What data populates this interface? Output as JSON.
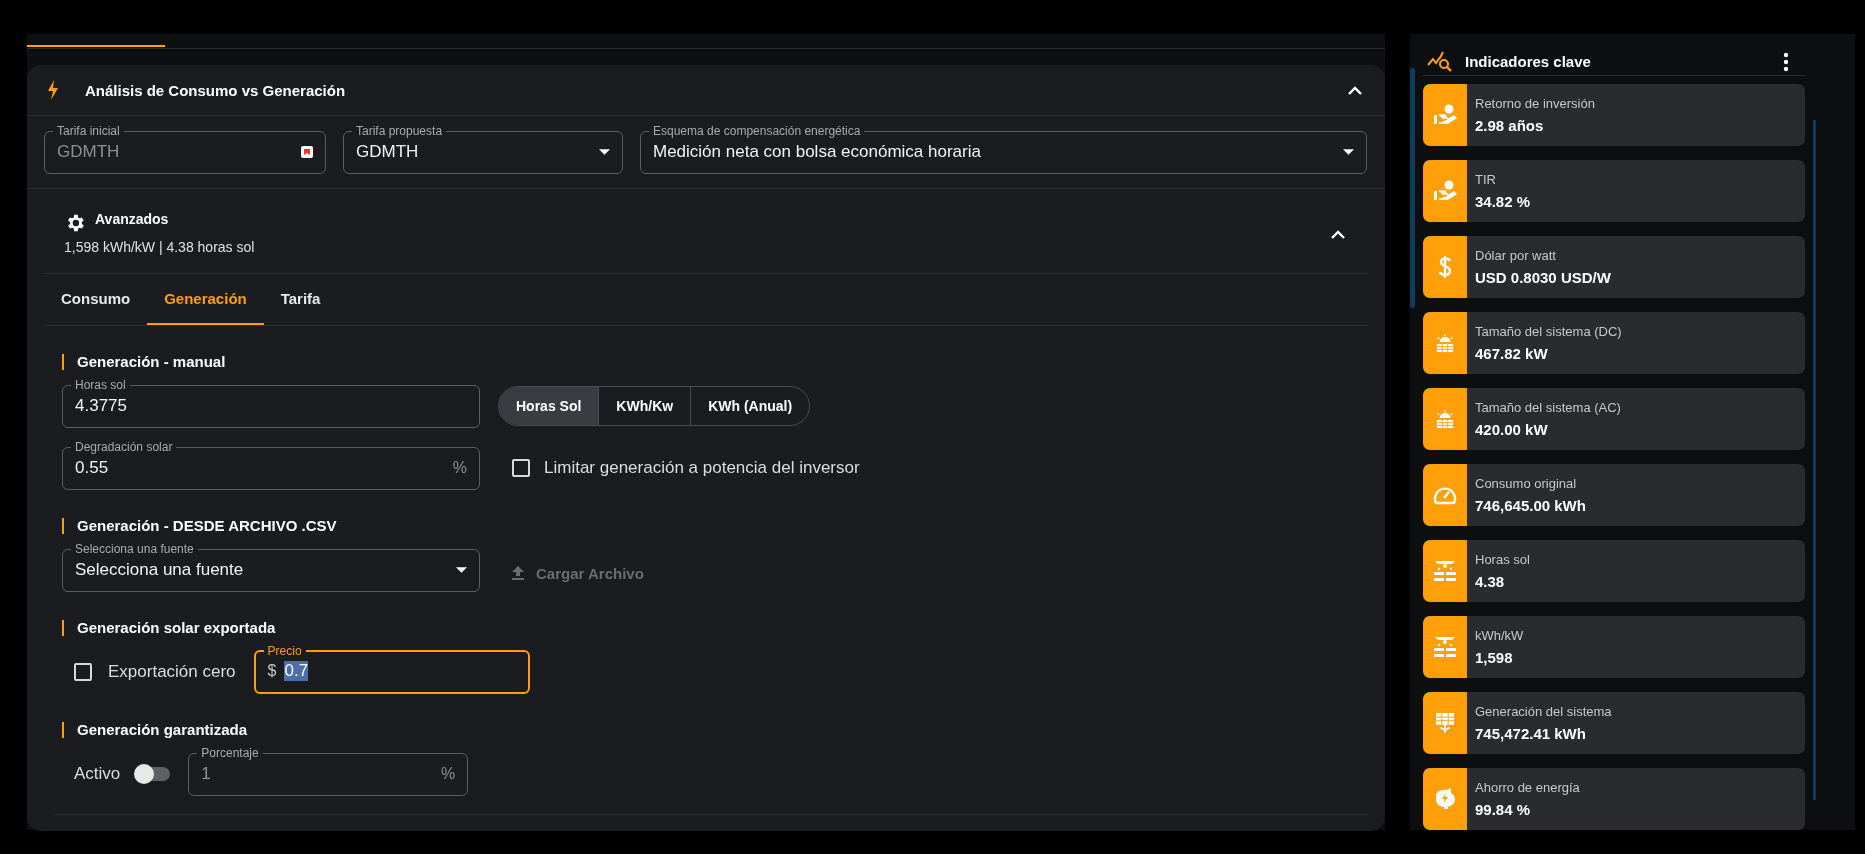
{
  "panel": {
    "title": "Análisis de Consumo vs Generación",
    "expanded": true,
    "fields": [
      {
        "label": "Tarifa inicial",
        "value": "GDMTH",
        "kind": "readonly"
      },
      {
        "label": "Tarifa propuesta",
        "value": "GDMTH",
        "kind": "select"
      },
      {
        "label": "Esquema de compensación energética",
        "value": "Medición neta con bolsa económica horaria",
        "kind": "select"
      }
    ],
    "advanced": {
      "title": "Avanzados",
      "summary": "1,598 kWh/kW | 4.38 horas sol",
      "expanded": true,
      "tabs": [
        {
          "label": "Consumo",
          "selected": false
        },
        {
          "label": "Generación",
          "selected": true
        },
        {
          "label": "Tarifa",
          "selected": false
        }
      ],
      "gen_manual": {
        "title": "Generación - manual",
        "hours": {
          "label": "Horas sol",
          "value": "4.3775"
        },
        "degradation": {
          "label": "Degradación solar",
          "value": "0.55",
          "suffix": "%"
        },
        "units": [
          {
            "label": "Horas Sol",
            "selected": true
          },
          {
            "label": "KWh/Kw",
            "selected": false
          },
          {
            "label": "KWh (Anual)",
            "selected": false
          }
        ],
        "limit": {
          "label": "Limitar generación a potencia del inversor",
          "checked": false
        }
      },
      "gen_csv": {
        "title": "Generación - DESDE ARCHIVO .CSV",
        "source": {
          "label": "Selecciona una fuente",
          "value": "Selecciona una fuente"
        },
        "upload": {
          "label": "Cargar Archivo",
          "disabled": true
        }
      },
      "gen_export": {
        "title": "Generación solar exportada",
        "zero": {
          "label": "Exportación cero",
          "checked": false
        },
        "price": {
          "label": "Precio",
          "prefix": "$",
          "value": "0.7",
          "focused": true,
          "text_selected": true
        }
      },
      "gen_guaranteed": {
        "title": "Generación garantizada",
        "active": {
          "label": "Activo",
          "on": false
        },
        "percent": {
          "label": "Porcentaje",
          "value": "1",
          "suffix": "%",
          "disabled": true
        }
      }
    }
  },
  "sidebar": {
    "title": "Indicadores clave",
    "items": [
      {
        "label": "Retorno de inversión",
        "value": "2.98 años"
      },
      {
        "label": "TIR",
        "value": "34.82 %"
      },
      {
        "label": "Dólar por watt",
        "value": "USD 0.8030 USD/W"
      },
      {
        "label": "Tamaño del sistema (DC)",
        "value": "467.82 kW"
      },
      {
        "label": "Tamaño del sistema (AC)",
        "value": "420.00 kW"
      },
      {
        "label": "Consumo original",
        "value": "746,645.00 kWh"
      },
      {
        "label": "Horas sol",
        "value": "4.38"
      },
      {
        "label": "kWh/kW",
        "value": "1,598"
      },
      {
        "label": "Generación del sistema",
        "value": "745,472.41 kWh"
      },
      {
        "label": "Ahorro de energía",
        "value": "99.84 %"
      }
    ]
  }
}
